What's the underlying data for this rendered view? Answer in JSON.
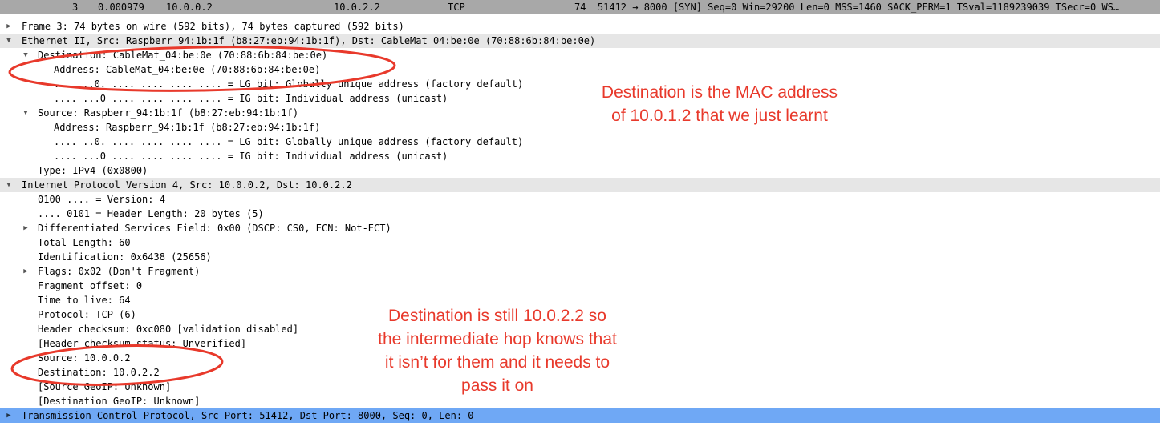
{
  "packet_list": {
    "no": "3",
    "time": "0.000979",
    "source": "10.0.0.2",
    "destination": "10.0.2.2",
    "protocol": "TCP",
    "info": "74  51412 → 8000 [SYN] Seq=0 Win=29200 Len=0 MSS=1460 SACK_PERM=1 TSval=1189239039 TSecr=0 WS…"
  },
  "tree": {
    "frame": "Frame 3: 74 bytes on wire (592 bits), 74 bytes captured (592 bits)",
    "ethernet": "Ethernet II, Src: Raspberr_94:1b:1f (b8:27:eb:94:1b:1f), Dst: CableMat_04:be:0e (70:88:6b:84:be:0e)",
    "eth_dst": "Destination: CableMat_04:be:0e (70:88:6b:84:be:0e)",
    "eth_dst_address": "Address: CableMat_04:be:0e (70:88:6b:84:be:0e)",
    "eth_dst_lg": ".... ..0. .... .... .... .... = LG bit: Globally unique address (factory default)",
    "eth_dst_ig": ".... ...0 .... .... .... .... = IG bit: Individual address (unicast)",
    "eth_src": "Source: Raspberr_94:1b:1f (b8:27:eb:94:1b:1f)",
    "eth_src_address": "Address: Raspberr_94:1b:1f (b8:27:eb:94:1b:1f)",
    "eth_src_lg": ".... ..0. .... .... .... .... = LG bit: Globally unique address (factory default)",
    "eth_src_ig": ".... ...0 .... .... .... .... = IG bit: Individual address (unicast)",
    "eth_type": "Type: IPv4 (0x0800)",
    "ip": "Internet Protocol Version 4, Src: 10.0.0.2, Dst: 10.0.2.2",
    "ip_version": "0100 .... = Version: 4",
    "ip_hlen": ".... 0101 = Header Length: 20 bytes (5)",
    "ip_dsf": "Differentiated Services Field: 0x00 (DSCP: CS0, ECN: Not-ECT)",
    "ip_total_len": "Total Length: 60",
    "ip_id": "Identification: 0x6438 (25656)",
    "ip_flags": "Flags: 0x02 (Don't Fragment)",
    "ip_frag": "Fragment offset: 0",
    "ip_ttl": "Time to live: 64",
    "ip_proto": "Protocol: TCP (6)",
    "ip_checksum": "Header checksum: 0xc080 [validation disabled]",
    "ip_checksum_status": "[Header checksum status: Unverified]",
    "ip_src": "Source: 10.0.0.2",
    "ip_dst": "Destination: 10.0.2.2",
    "ip_src_geo": "[Source GeoIP: Unknown]",
    "ip_dst_geo": "[Destination GeoIP: Unknown]",
    "tcp": "Transmission Control Protocol, Src Port: 51412, Dst Port: 8000, Seq: 0, Len: 0"
  },
  "annotations": {
    "mac_note": "Destination is the MAC address\nof 10.0.1.2 that we just learnt",
    "ip_note": "Destination is still 10.0.2.2 so\nthe intermediate hop knows that\nit isn’t for them and it needs to\npass it on"
  },
  "icons": {
    "collapsed": "disclosure-triangle-right",
    "expanded": "disclosure-triangle-down"
  },
  "colors": {
    "annotation": "#e8392b",
    "selection": "#6fa8f5",
    "packet_row": "#a8a8a8",
    "header_row": "#e6e6e6"
  }
}
